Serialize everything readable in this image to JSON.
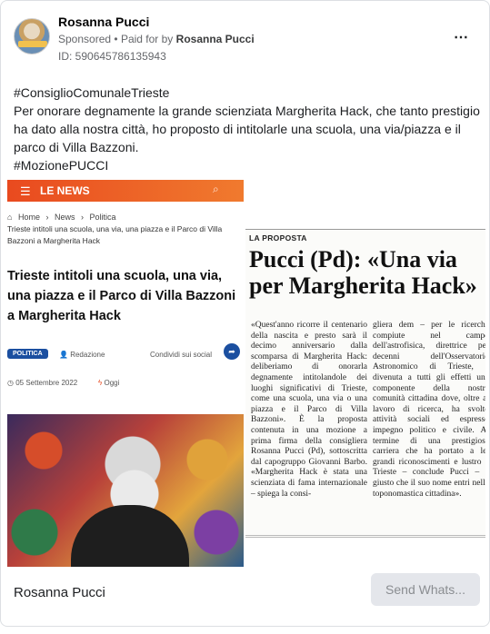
{
  "post": {
    "author": "Rosanna Pucci",
    "sponsored": "Sponsored",
    "paid_for_prefix": "Paid for by",
    "paid_for_name": "Rosanna Pucci",
    "ad_id": "ID: 590645786135943",
    "more_icon": "⋯",
    "text_lines": [
      "#ConsiglioComunaleTrieste",
      "Per onorare degnamente la grande scienziata Margherita Hack, che tanto prestigio ha dato alla nostra città, ho proposto di intitolarle una scuola, una via/piazza e il parco di Villa Bazzoni.",
      "#MozionePUCCI"
    ]
  },
  "web_article": {
    "brand": "LE NEWS",
    "menu_icon": "☰",
    "search_icon": "⌕",
    "breadcrumbs": [
      "Home",
      "News",
      "Politica"
    ],
    "crumb_sub": "Trieste intitoli una scuola, una via, una piazza e il Parco di Villa Bazzoni a Margherita Hack",
    "title": "Trieste intitoli una scuola, una via, una piazza e il Parco di Villa Bazzoni a Margherita Hack",
    "category": "POLITICA",
    "author": "Redazione",
    "share": "Condividi sui social",
    "date": "05 Settembre 2022",
    "today": "Oggi"
  },
  "newspaper": {
    "kicker": "LA PROPOSTA",
    "headline": "Pucci (Pd): «Una via per Margherita Hack»",
    "col_left": "«Quest'anno ricorre il centenario della nascita e presto sarà il decimo anniversario dalla scomparsa di Margherita Hack: deliberiamo di onorarla degnamente intitolandole dei luoghi significativi di Trieste, come una scuola, una via o una piazza e il Parco di Villa Bazzoni». È la proposta contenuta in una mozione a prima firma della consigliera Rosanna Pucci (Pd), sottoscritta dal capogruppo Giovanni Barbo. «Margherita Hack è stata una scienziata di fama internazionale – spiega la consi-",
    "col_right": "gliera dem – per le ricerche compiute nel campo dell'astrofisica, direttrice per decenni dell'Osservatorio Astronomico di Trieste, è divenuta a tutti gli effetti una componente della nostra comunità cittadina dove, oltre al lavoro di ricerca, ha svolto attività sociali ed espresso impegno politico e civile. Al termine di una prestigiosa carriera che ha portato a lei grandi riconoscimenti e lustro a Trieste – conclude Pucci – è giusto che il suo nome entri nella toponomastica cittadina»."
  },
  "footer": {
    "page_name": "Rosanna Pucci",
    "send_button": "Send Whats..."
  }
}
